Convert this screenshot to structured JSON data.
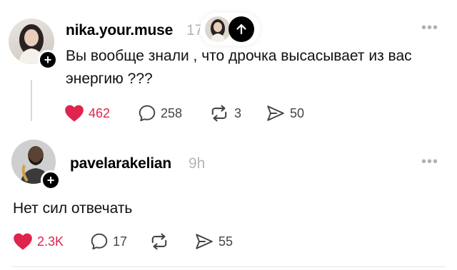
{
  "post": {
    "username": "nika.your.muse",
    "time": "17",
    "more": "•••",
    "text": "Вы вообще знали , что дрочка высасывает из вас энергию ???",
    "likes": "462",
    "comments": "258",
    "reposts": "3",
    "shares": "50"
  },
  "reply": {
    "username": "pavelarakelian",
    "time": "9h",
    "more": "•••",
    "text": "Нет сил отвечать",
    "likes": "2.3K",
    "comments": "17",
    "reposts": "",
    "shares": "55"
  },
  "icons": {
    "like": "heart-icon",
    "comment": "comment-bubble-icon",
    "repost": "repost-icon",
    "share": "send-icon",
    "follow": "plus-icon",
    "scroll_up": "arrow-up-icon"
  },
  "colors": {
    "like_active": "#e0244d",
    "muted": "#b5b5b5",
    "text": "#111111"
  }
}
